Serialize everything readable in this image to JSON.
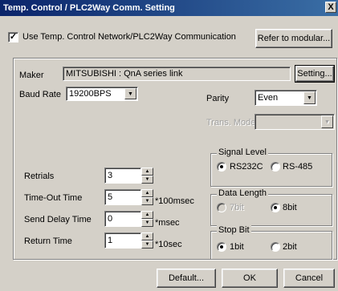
{
  "window": {
    "title": "Temp. Control / PLC2Way Comm. Setting",
    "close_glyph": "X"
  },
  "use_network": {
    "label": "Use Temp. Control Network/PLC2Way Communication",
    "checked": true,
    "check_glyph": "✓"
  },
  "refer_button": {
    "label": "Refer to modular..."
  },
  "maker": {
    "label": "Maker",
    "value": "MITSUBISHI : QnA series link",
    "setting_label": "Setting..."
  },
  "baud_rate": {
    "label": "Baud Rate",
    "value": "19200BPS"
  },
  "parity": {
    "label": "Parity",
    "value": "Even"
  },
  "trans_mode": {
    "label": "Trans. Mode",
    "value": ""
  },
  "dropdown_glyph": "▼",
  "spin_up_glyph": "▲",
  "spin_down_glyph": "▼",
  "signal_level": {
    "title": "Signal Level",
    "options": [
      {
        "label": "RS232C",
        "selected": true
      },
      {
        "label": "RS-485",
        "selected": false
      }
    ]
  },
  "data_length": {
    "title": "Data Length",
    "options": [
      {
        "label": "7bit",
        "selected": false,
        "disabled": true
      },
      {
        "label": "8bit",
        "selected": true
      }
    ]
  },
  "stop_bit": {
    "title": "Stop Bit",
    "options": [
      {
        "label": "1bit",
        "selected": true
      },
      {
        "label": "2bit",
        "selected": false
      }
    ]
  },
  "retrials": {
    "label": "Retrials",
    "value": "3",
    "unit": ""
  },
  "timeout": {
    "label": "Time-Out Time",
    "value": "5",
    "unit": "*100msec"
  },
  "send_delay": {
    "label": "Send Delay Time",
    "value": "0",
    "unit": "*msec"
  },
  "return_time": {
    "label": "Return Time",
    "value": "1",
    "unit": "*10sec"
  },
  "buttons": {
    "default": "Default...",
    "ok": "OK",
    "cancel": "Cancel"
  }
}
